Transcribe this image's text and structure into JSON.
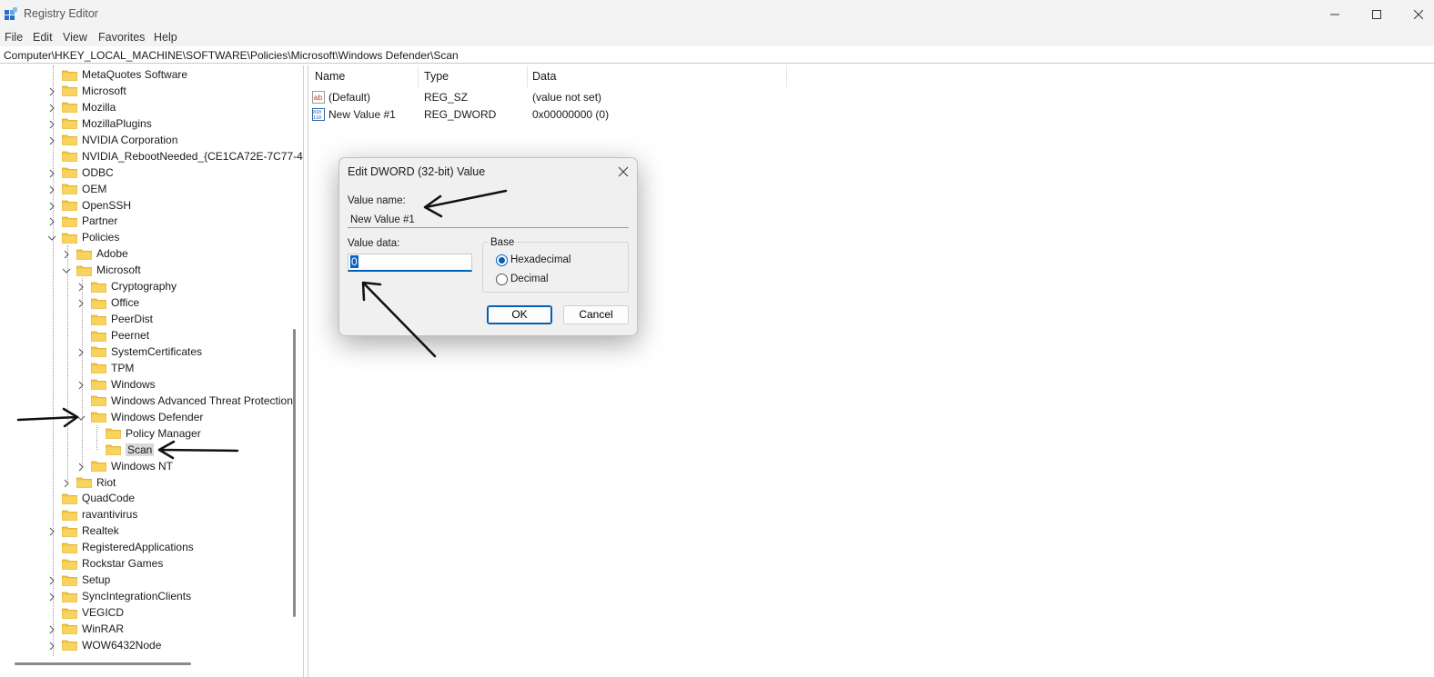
{
  "window": {
    "title": "Registry Editor",
    "menu": [
      "File",
      "Edit",
      "View",
      "Favorites",
      "Help"
    ]
  },
  "address": {
    "path": "Computer\\HKEY_LOCAL_MACHINE\\SOFTWARE\\Policies\\Microsoft\\Windows Defender\\Scan"
  },
  "tree": [
    {
      "label": "MetaQuotes Software",
      "level": 0,
      "expander": "none"
    },
    {
      "label": "Microsoft",
      "level": 0,
      "expander": "collapsed"
    },
    {
      "label": "Mozilla",
      "level": 0,
      "expander": "collapsed"
    },
    {
      "label": "MozillaPlugins",
      "level": 0,
      "expander": "collapsed"
    },
    {
      "label": "NVIDIA Corporation",
      "level": 0,
      "expander": "collapsed"
    },
    {
      "label": "NVIDIA_RebootNeeded_{CE1CA72E-7C77-4I",
      "level": 0,
      "expander": "none"
    },
    {
      "label": "ODBC",
      "level": 0,
      "expander": "collapsed"
    },
    {
      "label": "OEM",
      "level": 0,
      "expander": "collapsed"
    },
    {
      "label": "OpenSSH",
      "level": 0,
      "expander": "collapsed"
    },
    {
      "label": "Partner",
      "level": 0,
      "expander": "collapsed"
    },
    {
      "label": "Policies",
      "level": 0,
      "expander": "expanded"
    },
    {
      "label": "Adobe",
      "level": 1,
      "expander": "collapsed"
    },
    {
      "label": "Microsoft",
      "level": 1,
      "expander": "expanded"
    },
    {
      "label": "Cryptography",
      "level": 2,
      "expander": "collapsed"
    },
    {
      "label": "Office",
      "level": 2,
      "expander": "collapsed"
    },
    {
      "label": "PeerDist",
      "level": 2,
      "expander": "none"
    },
    {
      "label": "Peernet",
      "level": 2,
      "expander": "none"
    },
    {
      "label": "SystemCertificates",
      "level": 2,
      "expander": "collapsed"
    },
    {
      "label": "TPM",
      "level": 2,
      "expander": "none"
    },
    {
      "label": "Windows",
      "level": 2,
      "expander": "collapsed"
    },
    {
      "label": "Windows Advanced Threat Protection",
      "level": 2,
      "expander": "none"
    },
    {
      "label": "Windows Defender",
      "level": 2,
      "expander": "expanded"
    },
    {
      "label": "Policy Manager",
      "level": 3,
      "expander": "none"
    },
    {
      "label": "Scan",
      "level": 3,
      "expander": "none",
      "selected": true
    },
    {
      "label": "Windows NT",
      "level": 2,
      "expander": "collapsed"
    },
    {
      "label": "Riot",
      "level": 1,
      "expander": "collapsed"
    },
    {
      "label": "QuadCode",
      "level": 0,
      "expander": "none"
    },
    {
      "label": "ravantivirus",
      "level": 0,
      "expander": "none"
    },
    {
      "label": "Realtek",
      "level": 0,
      "expander": "collapsed"
    },
    {
      "label": "RegisteredApplications",
      "level": 0,
      "expander": "none"
    },
    {
      "label": "Rockstar Games",
      "level": 0,
      "expander": "none"
    },
    {
      "label": "Setup",
      "level": 0,
      "expander": "collapsed"
    },
    {
      "label": "SyncIntegrationClients",
      "level": 0,
      "expander": "collapsed"
    },
    {
      "label": "VEGICD",
      "level": 0,
      "expander": "none"
    },
    {
      "label": "WinRAR",
      "level": 0,
      "expander": "collapsed"
    },
    {
      "label": "WOW6432Node",
      "level": 0,
      "expander": "collapsed"
    }
  ],
  "values": {
    "columns": {
      "name": "Name",
      "type": "Type",
      "data": "Data"
    },
    "rows": [
      {
        "name": "(Default)",
        "type": "REG_SZ",
        "data": "(value not set)",
        "icon": "string-value-icon"
      },
      {
        "name": "New Value #1",
        "type": "REG_DWORD",
        "data": "0x00000000 (0)",
        "icon": "binary-value-icon"
      }
    ]
  },
  "dialog": {
    "title": "Edit DWORD (32-bit) Value",
    "value_name_label": "Value name:",
    "value_name": "New Value #1",
    "value_data_label": "Value data:",
    "value_data": "0",
    "base_label": "Base",
    "base_options": [
      {
        "label": "Hexadecimal",
        "selected": true
      },
      {
        "label": "Decimal",
        "selected": false
      }
    ],
    "ok_label": "OK",
    "cancel_label": "Cancel"
  },
  "colors": {
    "accent": "#005fb8",
    "folder": "#f5c542",
    "selection": "#d9d9d9"
  }
}
